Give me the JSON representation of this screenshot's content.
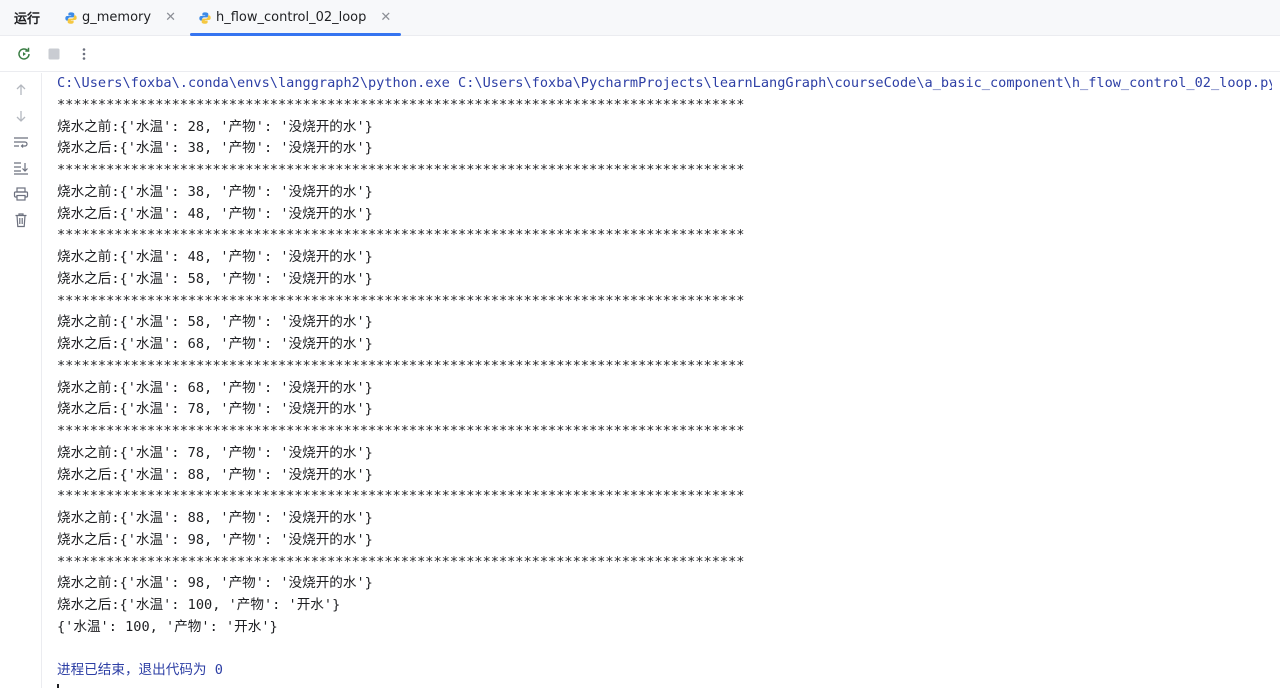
{
  "tabbar": {
    "run_label": "运行",
    "tabs": [
      {
        "label": "g_memory",
        "active": false
      },
      {
        "label": "h_flow_control_02_loop",
        "active": true
      }
    ]
  },
  "colors": {
    "accent": "#3574f0",
    "command_text": "#2d3fa5",
    "text": "#1e1f22"
  },
  "toolbar": {
    "icons": [
      "rerun-icon",
      "stop-icon",
      "more-options-icon"
    ]
  },
  "gutter": {
    "icons": [
      "scroll-up-icon",
      "scroll-down-icon",
      "soft-wrap-icon",
      "scroll-to-end-icon",
      "print-icon",
      "clear-icon"
    ]
  },
  "console": {
    "lines": [
      {
        "text": "C:\\Users\\foxba\\.conda\\envs\\langgraph2\\python.exe C:\\Users\\foxba\\PycharmProjects\\learnLangGraph\\courseCode\\a_basic_component\\h_flow_control_02_loop.py",
        "kind": "cmd"
      },
      {
        "text": "************************************************************************************",
        "kind": "out"
      },
      {
        "text": "烧水之前:{'水温': 28, '产物': '没烧开的水'}",
        "kind": "out"
      },
      {
        "text": "烧水之后:{'水温': 38, '产物': '没烧开的水'}",
        "kind": "out"
      },
      {
        "text": "************************************************************************************",
        "kind": "out"
      },
      {
        "text": "烧水之前:{'水温': 38, '产物': '没烧开的水'}",
        "kind": "out"
      },
      {
        "text": "烧水之后:{'水温': 48, '产物': '没烧开的水'}",
        "kind": "out"
      },
      {
        "text": "************************************************************************************",
        "kind": "out"
      },
      {
        "text": "烧水之前:{'水温': 48, '产物': '没烧开的水'}",
        "kind": "out"
      },
      {
        "text": "烧水之后:{'水温': 58, '产物': '没烧开的水'}",
        "kind": "out"
      },
      {
        "text": "************************************************************************************",
        "kind": "out"
      },
      {
        "text": "烧水之前:{'水温': 58, '产物': '没烧开的水'}",
        "kind": "out"
      },
      {
        "text": "烧水之后:{'水温': 68, '产物': '没烧开的水'}",
        "kind": "out"
      },
      {
        "text": "************************************************************************************",
        "kind": "out"
      },
      {
        "text": "烧水之前:{'水温': 68, '产物': '没烧开的水'}",
        "kind": "out"
      },
      {
        "text": "烧水之后:{'水温': 78, '产物': '没烧开的水'}",
        "kind": "out"
      },
      {
        "text": "************************************************************************************",
        "kind": "out"
      },
      {
        "text": "烧水之前:{'水温': 78, '产物': '没烧开的水'}",
        "kind": "out"
      },
      {
        "text": "烧水之后:{'水温': 88, '产物': '没烧开的水'}",
        "kind": "out"
      },
      {
        "text": "************************************************************************************",
        "kind": "out"
      },
      {
        "text": "烧水之前:{'水温': 88, '产物': '没烧开的水'}",
        "kind": "out"
      },
      {
        "text": "烧水之后:{'水温': 98, '产物': '没烧开的水'}",
        "kind": "out"
      },
      {
        "text": "************************************************************************************",
        "kind": "out"
      },
      {
        "text": "烧水之前:{'水温': 98, '产物': '没烧开的水'}",
        "kind": "out"
      },
      {
        "text": "烧水之后:{'水温': 100, '产物': '开水'}",
        "kind": "out"
      },
      {
        "text": "{'水温': 100, '产物': '开水'}",
        "kind": "out"
      },
      {
        "text": "",
        "kind": "blank"
      },
      {
        "text": "进程已结束，退出代码为 0",
        "kind": "exit"
      }
    ]
  }
}
